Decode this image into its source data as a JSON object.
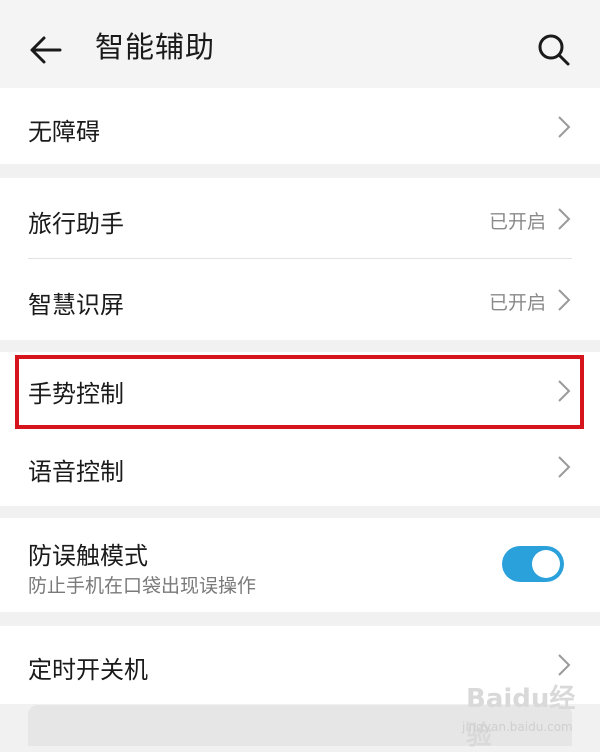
{
  "header": {
    "title": "智能辅助",
    "back_icon": "arrow-left-icon",
    "search_icon": "search-icon"
  },
  "groups": [
    {
      "items": [
        {
          "label": "无障碍",
          "value": ""
        }
      ]
    },
    {
      "items": [
        {
          "label": "旅行助手",
          "value": "已开启"
        },
        {
          "label": "智慧识屏",
          "value": "已开启"
        }
      ]
    },
    {
      "items": [
        {
          "label": "手势控制",
          "value": ""
        },
        {
          "label": "语音控制",
          "value": ""
        }
      ]
    },
    {
      "items": [
        {
          "label": "防误触模式",
          "subtitle": "防止手机在口袋出现误操作",
          "toggle_on": true
        }
      ]
    },
    {
      "items": [
        {
          "label": "定时开关机",
          "value": ""
        }
      ]
    }
  ],
  "highlight_color": "#d6141c",
  "accent_color": "#2aa1db",
  "watermark": {
    "brand": "Baidu经验",
    "site": "jingyan.baidu.com"
  }
}
